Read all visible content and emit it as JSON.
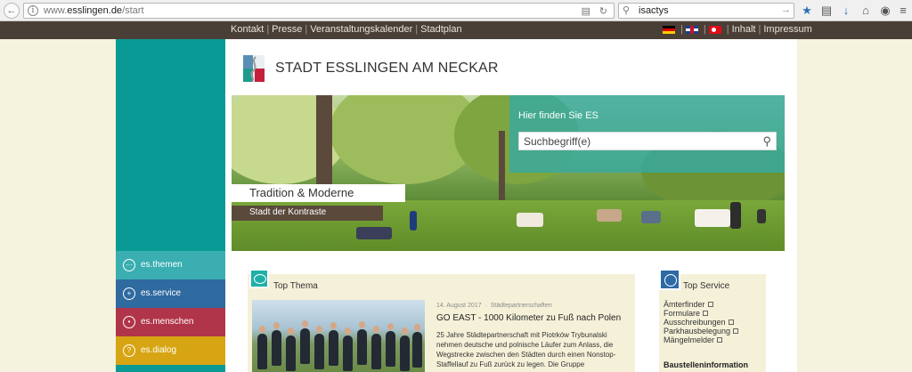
{
  "browser": {
    "url_prefix": "www.",
    "url_domain": "esslingen.de",
    "url_path": "/start",
    "search_text": "isactys"
  },
  "topbar": {
    "links": [
      "Kontakt",
      "Presse",
      "Veranstaltungskalender",
      "Stadtplan"
    ],
    "right_links": [
      "Inhalt",
      "Impressum"
    ]
  },
  "logo": {
    "text": "STADT ESSLINGEN AM NECKAR"
  },
  "hero": {
    "search_title": "Hier finden Sie ES",
    "search_placeholder": "Suchbegriff(e)",
    "tag_title": "Tradition & Moderne",
    "tag_subtitle": "Stadt der Kontraste"
  },
  "sidebar": {
    "items": [
      {
        "label": "es.themen",
        "color": "#3aaeb0"
      },
      {
        "label": "es.service",
        "color": "#2f6aa0"
      },
      {
        "label": "es.menschen",
        "color": "#b1354a"
      },
      {
        "label": "es.dialog",
        "color": "#d7a514"
      }
    ]
  },
  "thema": {
    "title": "Top Thema",
    "date": "14. August 2017",
    "category": "Städtepartnerschaften",
    "headline": "GO EAST - 1000 Kilometer zu Fuß nach Polen",
    "body": "25 Jahre Städtepartnerschaft mit Piotrków Trybunalski nehmen deutsche und polnische Läufer zum Anlass, die Wegstrecke zwischen den Städten durch einen Nonstop-Staffellauf zu Fuß zurück zu legen. Die Gruppe"
  },
  "service": {
    "title": "Top Service",
    "items": [
      "Ämterfinder",
      "Formulare",
      "Ausschreibungen",
      "Parkhausbelegung",
      "Mängelmelder"
    ],
    "subheading": "Baustelleninformation"
  },
  "colors": {
    "teal": "#0a9a96",
    "topbar": "#4a3f37",
    "page_bg": "#f5f2dd"
  }
}
